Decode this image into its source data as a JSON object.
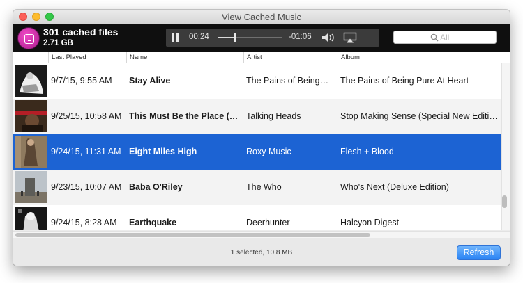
{
  "window": {
    "title": "View Cached Music"
  },
  "header": {
    "count_title": "301 cached files",
    "size_label": "2.71 GB"
  },
  "player": {
    "elapsed": "00:24",
    "remaining": "-01:06",
    "progress_fraction": 0.27
  },
  "search": {
    "placeholder": "All",
    "value": ""
  },
  "table": {
    "columns": [
      "Last Played",
      "Name",
      "Artist",
      "Album"
    ],
    "rows": [
      {
        "last_played": "9/7/15, 9:55 AM",
        "name": "Stay Alive",
        "artist": "The Pains of Being…",
        "album": "The Pains of Being Pure At Heart",
        "selected": false
      },
      {
        "last_played": "9/25/15, 10:58 AM",
        "name": "This Must Be the Place (…",
        "artist": "Talking Heads",
        "album": "Stop Making Sense (Special New Edition)",
        "selected": false
      },
      {
        "last_played": "9/24/15, 11:31 AM",
        "name": "Eight Miles High",
        "artist": "Roxy Music",
        "album": "Flesh + Blood",
        "selected": true
      },
      {
        "last_played": "9/23/15, 10:07 AM",
        "name": "Baba O'Riley",
        "artist": "The Who",
        "album": "Who's Next (Deluxe Edition)",
        "selected": false
      },
      {
        "last_played": "9/24/15, 8:28 AM",
        "name": "Earthquake",
        "artist": "Deerhunter",
        "album": "Halcyon Digest",
        "selected": false
      }
    ]
  },
  "footer": {
    "status": "1 selected, 10.8 MB",
    "refresh_label": "Refresh"
  },
  "colors": {
    "selection": "#1c63d3",
    "header_bar": "#0f0f0f",
    "refresh_button": "#2a83f4"
  }
}
